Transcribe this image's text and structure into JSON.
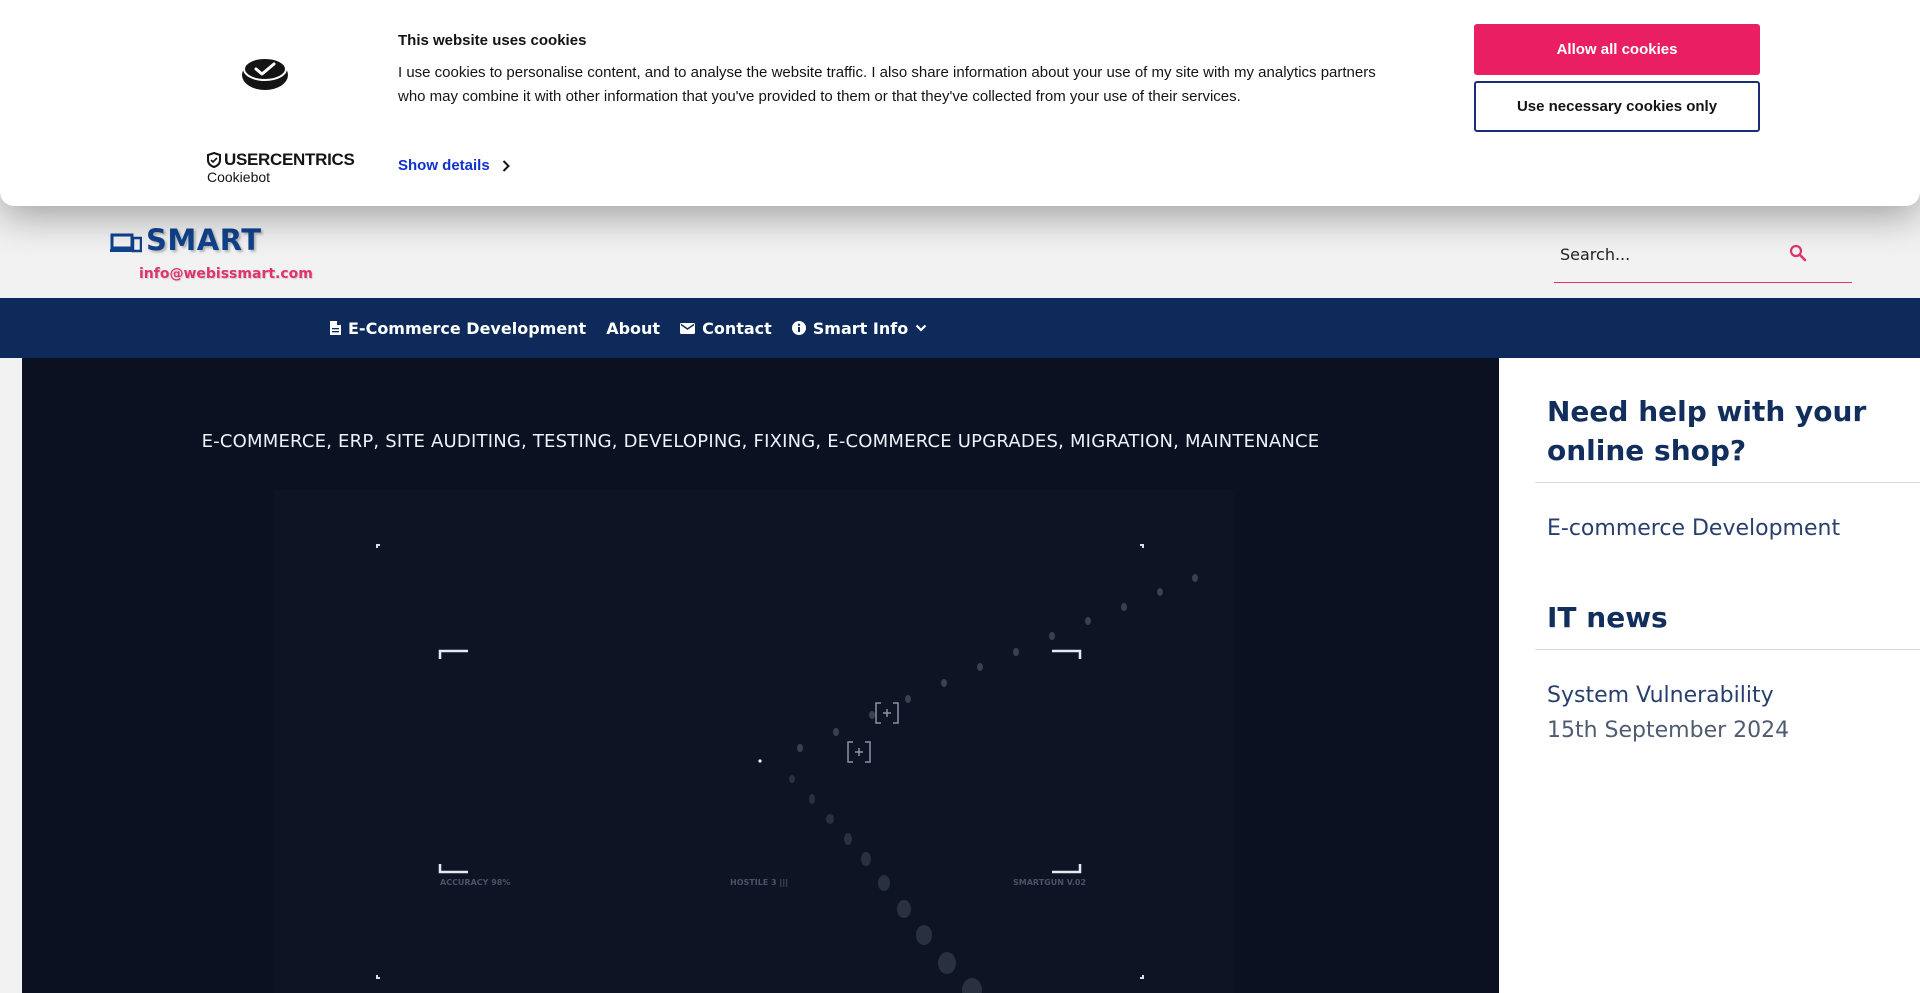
{
  "cookie_banner": {
    "title": "This website uses cookies",
    "text": "I use cookies to personalise content, and to analyse the website traffic. I also share information about your use of my site with my analytics partners who may combine it with other information that you've provided to them or that they've collected from your use of their services.",
    "show_details": "Show details",
    "allow_all": "Allow all cookies",
    "necessary_only": "Use necessary cookies only",
    "brand_name": "USERCENTRICS",
    "brand_sub": "Cookiebot",
    "accent_color": "#e91e63",
    "link_color": "#1032cf"
  },
  "header": {
    "logo_text": "SMART",
    "email": "info@webissmart.com",
    "search_placeholder": "Search..."
  },
  "nav": {
    "items": [
      {
        "label": "E-Commerce Development",
        "icon": "document-icon"
      },
      {
        "label": "About",
        "icon": ""
      },
      {
        "label": "Contact",
        "icon": "envelope-icon"
      },
      {
        "label": "Smart Info",
        "icon": "info-icon",
        "has_dropdown": true
      }
    ],
    "background_color": "#0d2a5a"
  },
  "hero": {
    "tagline": "E-COMMERCE, ERP, SITE AUDITING, TESTING, DEVELOPING, FIXING, E-COMMERCE UPGRADES, MIGRATION, MAINTENANCE",
    "hud_labels": [
      "ACCURACY 98%",
      "HOSTILE 3 |||",
      "SMARTGUN V.02"
    ]
  },
  "sidebar": {
    "help_heading": "Need help with your online shop?",
    "help_link": "E-commerce Development",
    "news_heading": "IT news",
    "news_item_title": "System Vulnerability",
    "news_item_date": "15th September 2024"
  }
}
